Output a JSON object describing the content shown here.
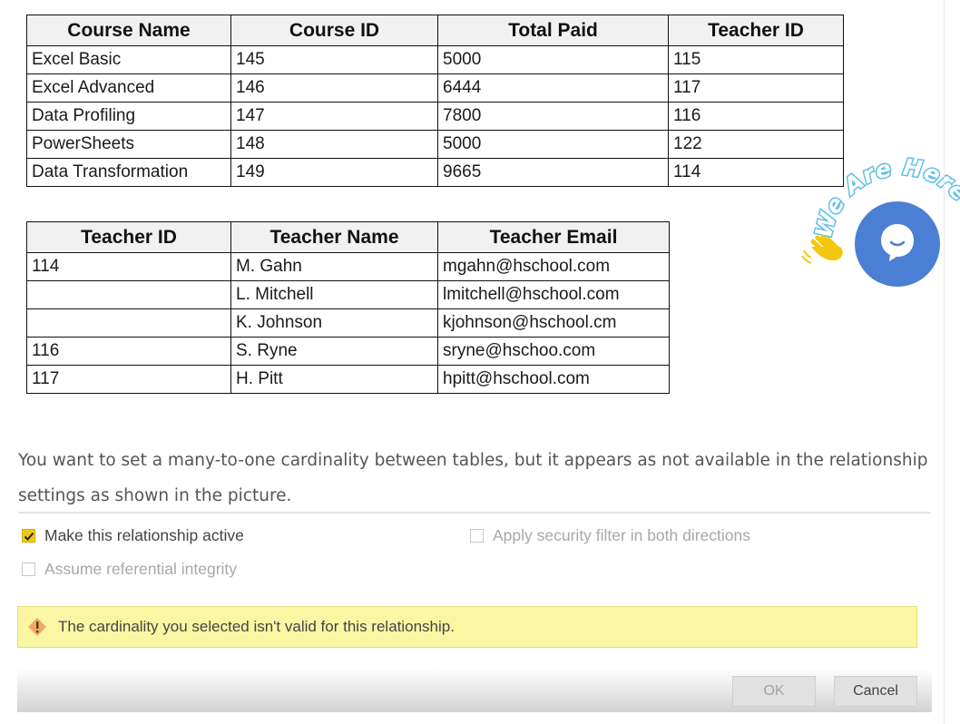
{
  "courses_table": {
    "headers": [
      "Course Name",
      "Course ID",
      "Total Paid",
      "Teacher ID"
    ],
    "rows": [
      [
        "Excel Basic",
        "145",
        "5000",
        "115"
      ],
      [
        "Excel Advanced",
        "146",
        "6444",
        "117"
      ],
      [
        "Data Profiling",
        "147",
        "7800",
        "116"
      ],
      [
        "PowerSheets",
        "148",
        "5000",
        "122"
      ],
      [
        "Data Transformation",
        "149",
        "9665",
        "114"
      ]
    ]
  },
  "teachers_table": {
    "headers": [
      "Teacher ID",
      "Teacher Name",
      "Teacher Email"
    ],
    "rows": [
      [
        "114",
        "M. Gahn",
        "mgahn@hschool.com"
      ],
      [
        "",
        "L. Mitchell",
        "lmitchell@hschool.com"
      ],
      [
        "",
        "K. Johnson",
        "kjohnson@hschool.cm"
      ],
      [
        "116",
        "S. Ryne",
        "sryne@hschoo.com"
      ],
      [
        "117",
        "H. Pitt",
        "hpitt@hschool.com"
      ]
    ]
  },
  "question": {
    "line1": "You want to set a many-to-one cardinality between tables, but it appears as not available in the relationship",
    "line2": "settings as shown in the picture."
  },
  "options": {
    "make_active": {
      "label": "Make this relationship active",
      "checked": true
    },
    "security_filter": {
      "label": "Apply security filter in both directions",
      "checked": false,
      "enabled": false
    },
    "referential_integrity": {
      "label": "Assume referential integrity",
      "checked": false,
      "enabled": false
    }
  },
  "warning": {
    "text": "The cardinality you selected isn't valid for this relationship.",
    "icon": "warning-icon",
    "color": "#fbf6a4"
  },
  "buttons": {
    "ok": "OK",
    "cancel": "Cancel"
  },
  "chat_widget": {
    "text": "We Are Here!",
    "icon": "chat-bubble-icon",
    "color": "#4b7fd4"
  },
  "colors": {
    "checkbox_checked": "#f2c811"
  }
}
